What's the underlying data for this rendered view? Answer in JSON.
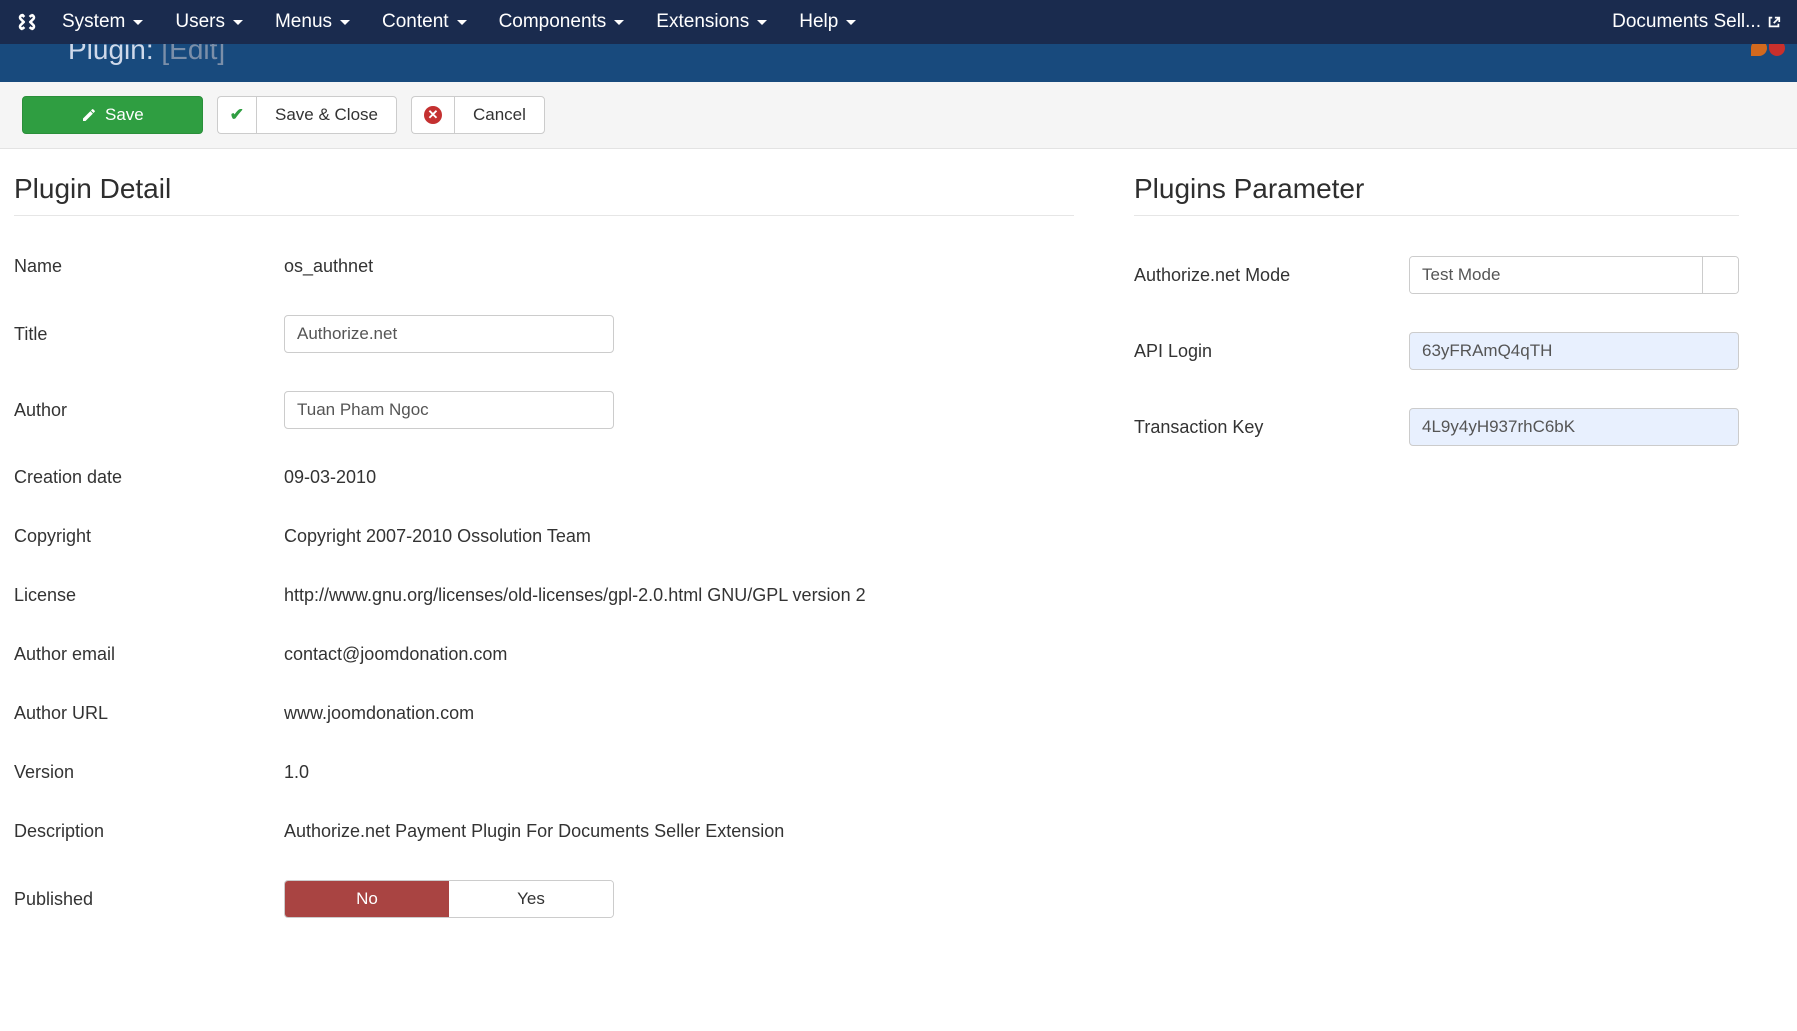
{
  "navbar": {
    "items": [
      "System",
      "Users",
      "Menus",
      "Content",
      "Components",
      "Extensions",
      "Help"
    ],
    "right_link": "Documents Sell..."
  },
  "header": {
    "title_main": "Plugin:",
    "title_sub": "[Edit]",
    "logo_text": "JOOMLA"
  },
  "toolbar": {
    "save": "Save",
    "save_close": "Save & Close",
    "cancel": "Cancel"
  },
  "sections": {
    "plugin_detail": "Plugin Detail",
    "plugins_parameter": "Plugins Parameter"
  },
  "detail": {
    "labels": {
      "name": "Name",
      "title": "Title",
      "author": "Author",
      "creation_date": "Creation date",
      "copyright": "Copyright",
      "license": "License",
      "author_email": "Author email",
      "author_url": "Author URL",
      "version": "Version",
      "description": "Description",
      "published": "Published"
    },
    "values": {
      "name": "os_authnet",
      "title": "Authorize.net",
      "author": "Tuan Pham Ngoc",
      "creation_date": "09-03-2010",
      "copyright": "Copyright 2007-2010 Ossolution Team",
      "license": "http://www.gnu.org/licenses/old-licenses/gpl-2.0.html GNU/GPL version 2",
      "author_email": "contact@joomdonation.com",
      "author_url": "www.joomdonation.com",
      "version": "1.0",
      "description": "Authorize.net Payment Plugin For Documents Seller Extension"
    },
    "published_options": {
      "no": "No",
      "yes": "Yes",
      "active": "no"
    }
  },
  "params": {
    "labels": {
      "mode": "Authorize.net Mode",
      "api_login": "API Login",
      "transaction_key": "Transaction Key"
    },
    "values": {
      "mode": "Test Mode",
      "api_login": "63yFRAmQ4qTH",
      "transaction_key": "4L9y4yH937rhC6bK"
    }
  }
}
